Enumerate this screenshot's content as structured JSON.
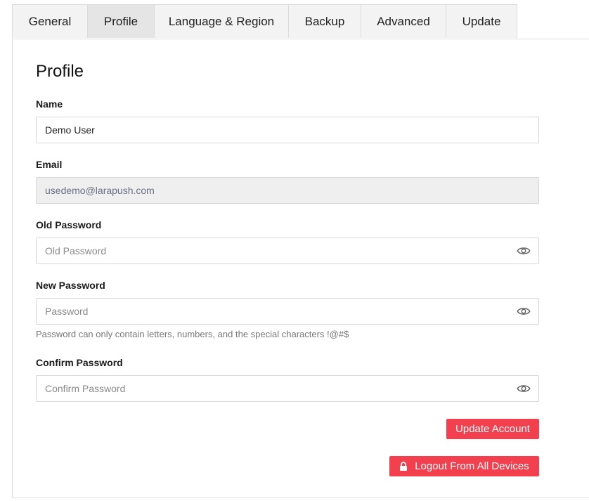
{
  "tabs": [
    {
      "label": "General",
      "active": false
    },
    {
      "label": "Profile",
      "active": true
    },
    {
      "label": "Language & Region",
      "active": false
    },
    {
      "label": "Backup",
      "active": false
    },
    {
      "label": "Advanced",
      "active": false
    },
    {
      "label": "Update",
      "active": false
    }
  ],
  "profile": {
    "title": "Profile",
    "name": {
      "label": "Name",
      "value": "Demo User"
    },
    "email": {
      "label": "Email",
      "value": "usedemo@larapush.com"
    },
    "old_password": {
      "label": "Old Password",
      "placeholder": "Old Password"
    },
    "new_password": {
      "label": "New Password",
      "placeholder": "Password",
      "hint": "Password can only contain letters, numbers, and the special characters !@#$"
    },
    "confirm_password": {
      "label": "Confirm Password",
      "placeholder": "Confirm Password"
    },
    "update_button": "Update Account",
    "logout_button": "Logout From All Devices"
  },
  "icons": {
    "eye": "eye-icon",
    "lock": "lock-icon"
  },
  "colors": {
    "accent": "#f2404f",
    "active_tab": "#e5e5e5",
    "tab_bg": "#f3f3f3"
  }
}
